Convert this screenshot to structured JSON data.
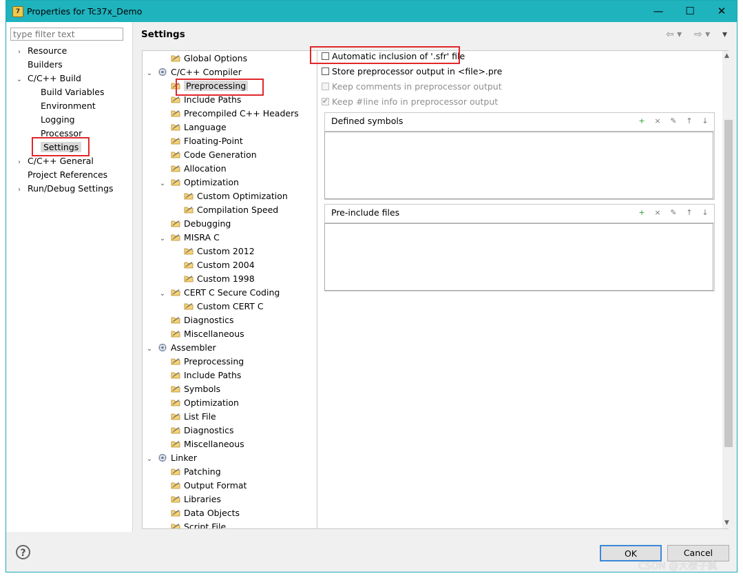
{
  "window": {
    "title": "Properties for Tc37x_Demo",
    "minimize": "—",
    "maximize": "☐",
    "close": "✕"
  },
  "filter": {
    "placeholder": "type filter text"
  },
  "nav": [
    {
      "label": "Resource",
      "tw": "›"
    },
    {
      "label": "Builders",
      "tw": ""
    },
    {
      "label": "C/C++ Build",
      "tw": "⌄"
    },
    {
      "label": "Build Variables",
      "tw": ""
    },
    {
      "label": "Environment",
      "tw": ""
    },
    {
      "label": "Logging",
      "tw": ""
    },
    {
      "label": "Processor",
      "tw": ""
    },
    {
      "label": "Settings",
      "tw": ""
    },
    {
      "label": "C/C++ General",
      "tw": "›"
    },
    {
      "label": "Project References",
      "tw": ""
    },
    {
      "label": "Run/Debug Settings",
      "tw": "›"
    }
  ],
  "header": {
    "title": "Settings",
    "back": "⇦ ▾",
    "fwd": "⇨ ▾",
    "menu": "▾"
  },
  "tree": [
    {
      "label": "Global Options"
    },
    {
      "label": "C/C++ Compiler",
      "tw": "⌄"
    },
    {
      "label": "Preprocessing"
    },
    {
      "label": "Include Paths"
    },
    {
      "label": "Precompiled C++ Headers"
    },
    {
      "label": "Language"
    },
    {
      "label": "Floating-Point"
    },
    {
      "label": "Code Generation"
    },
    {
      "label": "Allocation"
    },
    {
      "label": "Optimization",
      "tw": "⌄"
    },
    {
      "label": "Custom Optimization"
    },
    {
      "label": "Compilation Speed"
    },
    {
      "label": "Debugging"
    },
    {
      "label": "MISRA C",
      "tw": "⌄"
    },
    {
      "label": "Custom 2012"
    },
    {
      "label": "Custom 2004"
    },
    {
      "label": "Custom 1998"
    },
    {
      "label": "CERT C Secure Coding",
      "tw": "⌄"
    },
    {
      "label": "Custom CERT C"
    },
    {
      "label": "Diagnostics"
    },
    {
      "label": "Miscellaneous"
    },
    {
      "label": "Assembler",
      "tw": "⌄"
    },
    {
      "label": "Preprocessing"
    },
    {
      "label": "Include Paths"
    },
    {
      "label": "Symbols"
    },
    {
      "label": "Optimization"
    },
    {
      "label": "List File"
    },
    {
      "label": "Diagnostics"
    },
    {
      "label": "Miscellaneous"
    },
    {
      "label": "Linker",
      "tw": "⌄"
    },
    {
      "label": "Patching"
    },
    {
      "label": "Output Format"
    },
    {
      "label": "Libraries"
    },
    {
      "label": "Data Objects"
    },
    {
      "label": "Script File"
    }
  ],
  "options": {
    "auto_sfr": "Automatic inclusion of '.sfr' file",
    "store_pre": "Store preprocessor output in <file>.pre",
    "keep_comments": "Keep comments in preprocessor output",
    "keep_line": "Keep #line info in preprocessor output",
    "checkmark": "✔"
  },
  "groups": {
    "defined_symbols": "Defined symbols",
    "pre_include": "Pre-include files"
  },
  "buttons": {
    "help": "?",
    "ok": "OK",
    "cancel": "Cancel"
  },
  "watermark": "CSDN @大橙子疯"
}
